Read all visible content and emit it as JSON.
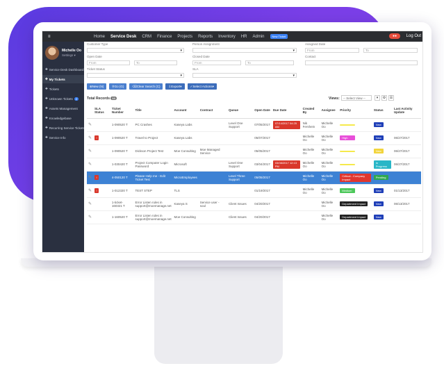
{
  "topbar": {
    "nav": [
      "Home",
      "Service Desk",
      "CRM",
      "Finance",
      "Projects",
      "Reports",
      "Inventory",
      "HR",
      "Admin"
    ],
    "active_index": 1,
    "new_badge": "New Ticket",
    "logout": "Log Out"
  },
  "sidebar": {
    "user_name": "Michelle Oo",
    "user_settings": "Settings",
    "items": [
      {
        "label": "Service Desk Dashboard",
        "active": false,
        "badge": ""
      },
      {
        "label": "My Tickets",
        "active": true,
        "badge": ""
      },
      {
        "label": "Tickets",
        "active": false,
        "badge": ""
      },
      {
        "label": "Unknown Tickets",
        "active": false,
        "badge": "2"
      },
      {
        "label": "Assets Management",
        "active": false,
        "badge": ""
      },
      {
        "label": "Knowledgebase",
        "active": false,
        "badge": ""
      },
      {
        "label": "Recurring Service Tickets",
        "active": false,
        "badge": ""
      },
      {
        "label": "Service Info",
        "active": false,
        "badge": ""
      }
    ]
  },
  "filters": {
    "customer_type": "Customer Type",
    "open_date": "Open Date",
    "from": "From",
    "to": "To",
    "ticket_status": "Ticket Status",
    "person_assignment": "Person Assignment",
    "closed_date": "Closed Date",
    "sla": "SLA",
    "assigned_date": "Assigned Date",
    "contact": "Contact"
  },
  "buttons": [
    "New (N)",
    "Go (G)",
    "Clear Search (C)",
    "Export",
    "Select Actions"
  ],
  "total_records_label": "Total Records",
  "total_records": "10",
  "views_label": "Views",
  "views_select": "-- Select View --",
  "table": {
    "headers": [
      "",
      "SLA Status",
      "Ticket Number",
      "Title",
      "Account",
      "Contract",
      "Queue",
      "Open Date",
      "Due Date",
      "Created By",
      "Assignee",
      "Priority",
      "Status",
      "Last Activity Update"
    ],
    "rows": [
      {
        "sla": "",
        "number": "1-090520 T",
        "title": "PC Crashes",
        "account": "Kaseya Labs",
        "contract": "",
        "queue": "Level One Support",
        "open": "07/05/2017",
        "due": "07/14/2017 04:25 AM",
        "created": "Nik Fershein",
        "assignee": "Michelle Oo",
        "priority": "",
        "pcolor": "#f5e94b",
        "status": "New",
        "scolor": "#1f3fb8",
        "last": ""
      },
      {
        "sla": "!",
        "number": "1-090520 T",
        "title": "Travel to Project",
        "account": "Kaseya Labs",
        "contract": "",
        "queue": "",
        "open": "05/07/2017",
        "due": "",
        "created": "Michelle Oo",
        "assignee": "Michelle Oo",
        "priority": "High",
        "pcolor": "#e84fd9",
        "status": "New",
        "scolor": "#1f3fb8",
        "last": "06/27/2017"
      },
      {
        "sla": "",
        "number": "1-090520 T",
        "title": "Dickson Project Test",
        "account": "Moe Consulting",
        "contract": "Moe Managed Service",
        "queue": "",
        "open": "05/05/2017",
        "due": "",
        "created": "Michelle Oo",
        "assignee": "Michelle Oo",
        "priority": "",
        "pcolor": "#f5e94b",
        "status": "New",
        "scolor": "#f2d43c",
        "last": "06/27/2017"
      },
      {
        "sla": "",
        "number": "1-030420 T",
        "title": "Project Computer Login Password",
        "account": "Microsoft",
        "contract": "",
        "queue": "Level One Support",
        "open": "03/04/2017",
        "due": "03/08/2017 12:13 PM",
        "created": "Michelle Oo",
        "assignee": "Michelle Oo",
        "priority": "",
        "pcolor": "#f5e94b",
        "status": "In Progress",
        "scolor": "#29b6c7",
        "last": "06/27/2017"
      },
      {
        "sla": "!",
        "number": "4-050120 T",
        "title": "Please Help me - Edit Ticket Test",
        "account": "MicroEmployees",
        "contract": "",
        "queue": "Level Three Support",
        "open": "05/05/2017",
        "due": "",
        "created": "Michelle Oo",
        "assignee": "Michelle Oo",
        "priority": "Critical - Company Impact",
        "pcolor": "#e0362e",
        "status": "Pending",
        "scolor": "#2fa84f",
        "last": "",
        "selected": true
      },
      {
        "sla": "!",
        "number": "1-012320 T",
        "title": "TEST STEP",
        "account": "TLS",
        "contract": "",
        "queue": "",
        "open": "01/19/2017",
        "due": "",
        "created": "Michelle Oo",
        "assignee": "Michelle Oo",
        "priority": "Medium",
        "pcolor": "#4cc85a",
        "status": "New",
        "scolor": "#1f3fb8",
        "last": "01/13/2017"
      },
      {
        "sla": "",
        "number": "1-ticket-160321 T",
        "title": "Error Listen rules in support@moemanage.net",
        "account": "Kaseya S",
        "contract": "Service user - soul",
        "queue": "Client Issues",
        "open": "04/20/2017",
        "due": "",
        "created": "",
        "assignee": "Michelle Oo",
        "priority": "Department Impact",
        "pcolor": "#222222",
        "status": "New",
        "scolor": "#1f3fb8",
        "last": "06/13/2017"
      },
      {
        "sla": "",
        "number": "1-160520 T",
        "title": "Error Listen rules in support@moemanage.net",
        "account": "Moe Consulting",
        "contract": "",
        "queue": "Client Issues",
        "open": "04/20/2017",
        "due": "",
        "created": "",
        "assignee": "Michelle Oo",
        "priority": "Department Impact",
        "pcolor": "#222222",
        "status": "New",
        "scolor": "#1f3fb8",
        "last": ""
      }
    ]
  },
  "colors": {
    "purple": "#6b3ee6",
    "topbar": "#2b2d31",
    "sidebar": "#2a3040",
    "button": "#4a7fcf",
    "selected_row": "#3d82d4"
  }
}
